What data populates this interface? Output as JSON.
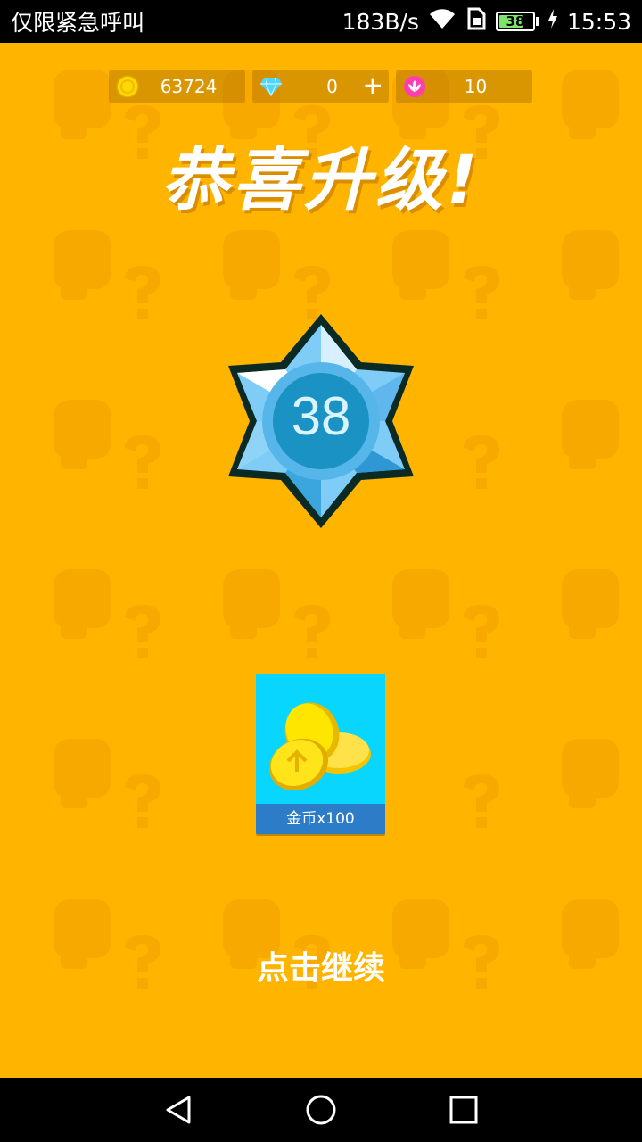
{
  "status_bar": {
    "left_text": "仅限紧急呼叫",
    "net_speed": "183B/s",
    "battery_level": "38",
    "time": "15:53"
  },
  "currencies": {
    "gold": {
      "value": "63724",
      "icon": "coin-icon"
    },
    "diamond": {
      "value": "0",
      "icon": "diamond-icon",
      "plus_label": "+"
    },
    "lotus": {
      "value": "10",
      "icon": "lotus-icon"
    }
  },
  "title": "恭喜升级!",
  "level": {
    "value": "38"
  },
  "reward": {
    "label": "金币x100",
    "icon": "gold-coins-icon"
  },
  "continue_label": "点击继续",
  "colors": {
    "background": "#ffb400",
    "card": "#08d6ff",
    "card_label": "#2d7cc8",
    "badge": "#5fc3f5"
  },
  "nav": {
    "back_icon": "back-icon",
    "home_icon": "home-icon",
    "recents_icon": "recents-icon"
  }
}
